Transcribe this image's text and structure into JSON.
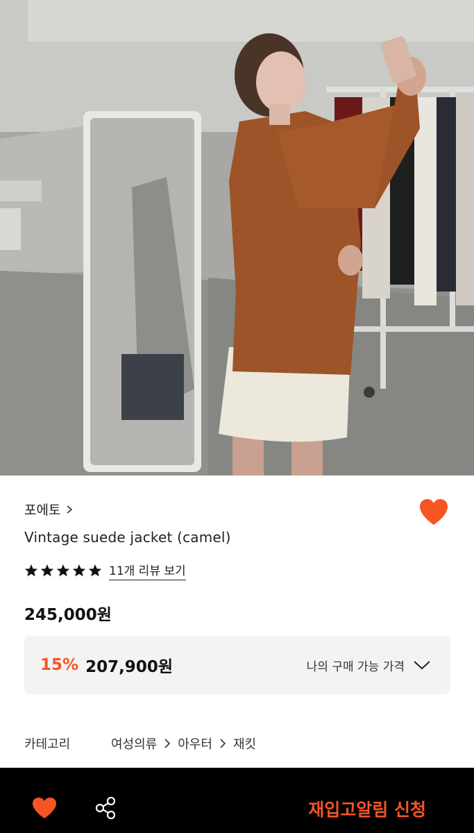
{
  "hero": {
    "image": "woman in camel suede jacket taking mirror selfie"
  },
  "product": {
    "brand": "포에토",
    "title": "Vintage suede jacket (camel)",
    "rating": 5,
    "review_link": "11개 리뷰 보기",
    "price": "245,000원",
    "discount": "15%",
    "sale_price": "207,900원",
    "my_price_label": "나의 구매 가능 가격",
    "favorited": true
  },
  "category": {
    "label": "카테고리",
    "path": [
      "여성의류",
      "아우터",
      "재킷"
    ]
  },
  "bottom_bar": {
    "restock_label": "재입고알림 신청"
  },
  "colors": {
    "accent": "#f55523",
    "bar": "#000000",
    "box": "#f3f3f3"
  }
}
